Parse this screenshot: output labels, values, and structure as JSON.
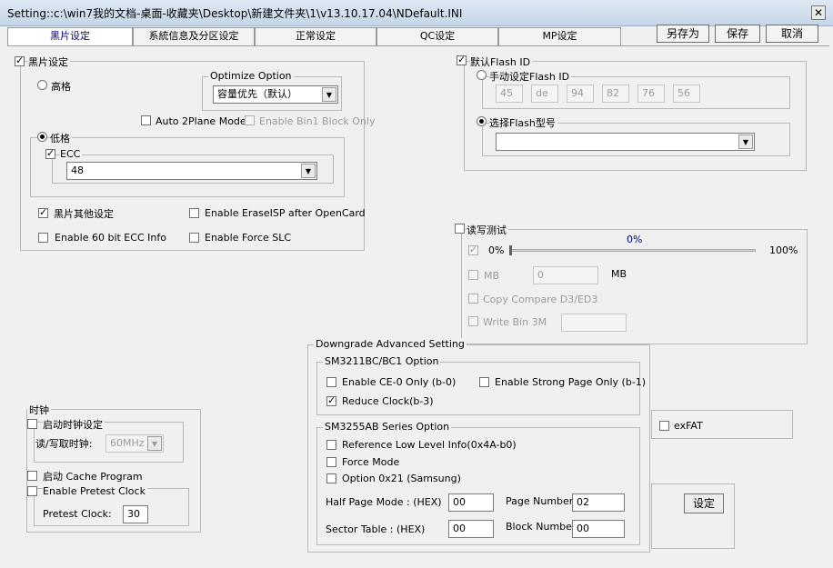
{
  "window": {
    "title": "Setting::c:\\win7我的文档-桌面-收藏夹\\Desktop\\新建文件夹\\1\\v13.10.17.04\\NDefault.INI",
    "close": "✕"
  },
  "tabs": [
    "黑片设定",
    "系統信息及分区设定",
    "正常设定",
    "QC设定",
    "MP设定"
  ],
  "top_buttons": {
    "save_as": "另存为",
    "save": "保存",
    "cancel": "取消"
  },
  "black": {
    "title": "黑片设定",
    "high": "高格",
    "optimize": {
      "title": "Optimize Option",
      "value": "容量优先（默认）"
    },
    "auto2plane": "Auto 2Plane Mode",
    "bin1": "Enable Bin1 Block Only",
    "low": "低格",
    "ecc": {
      "label": "ECC",
      "value": "48"
    },
    "other": "黑片其他设定",
    "erase_isp": "Enable EraseISP after OpenCard",
    "ecc60": "Enable 60 bit ECC Info",
    "force_slc": "Enable Force SLC"
  },
  "flash": {
    "title": "默认Flash ID",
    "manual": "手动设定Flash ID",
    "ids": [
      "45",
      "de",
      "94",
      "82",
      "76",
      "56"
    ],
    "select": "选择Flash型号",
    "select_value": ""
  },
  "rw": {
    "title": "读写测试",
    "progress": "0%",
    "min": "0%",
    "max": "100%",
    "mb": "MB",
    "mb_value": "0",
    "mb_unit": "MB",
    "copy": "Copy Compare D3/ED3",
    "write": "Write Bin 3M",
    "write_value": ""
  },
  "clock": {
    "title": "时钟",
    "enable": "启动时钟设定",
    "rw_label": "读/写取时钟:",
    "rw_value": "60MHz",
    "cache": "启动 Cache Program",
    "pretest": "Enable Pretest Clock",
    "pretest_label": "Pretest Clock:",
    "pretest_value": "30"
  },
  "downgrade": {
    "title": "Downgrade Advanced Setting",
    "sm3211": {
      "title": "SM3211BC/BC1 Option",
      "ce0": "Enable CE-0 Only (b-0)",
      "strong": "Enable Strong Page Only (b-1)",
      "reduce": "Reduce Clock(b-3)"
    },
    "sm3255": {
      "title": "SM3255AB Series Option",
      "ref": "Reference Low Level Info(0x4A-b0)",
      "force": "Force Mode",
      "opt21": "Option 0x21 (Samsung)",
      "half_label": "Half Page Mode : (HEX)",
      "half_value": "00",
      "page_label": "Page Number:",
      "page_value": "02",
      "sector_label": "Sector Table : (HEX)",
      "sector_value": "00",
      "block_label": "Block Number:",
      "block_value": "00"
    }
  },
  "exfat": "exFAT",
  "set_button": "设定"
}
